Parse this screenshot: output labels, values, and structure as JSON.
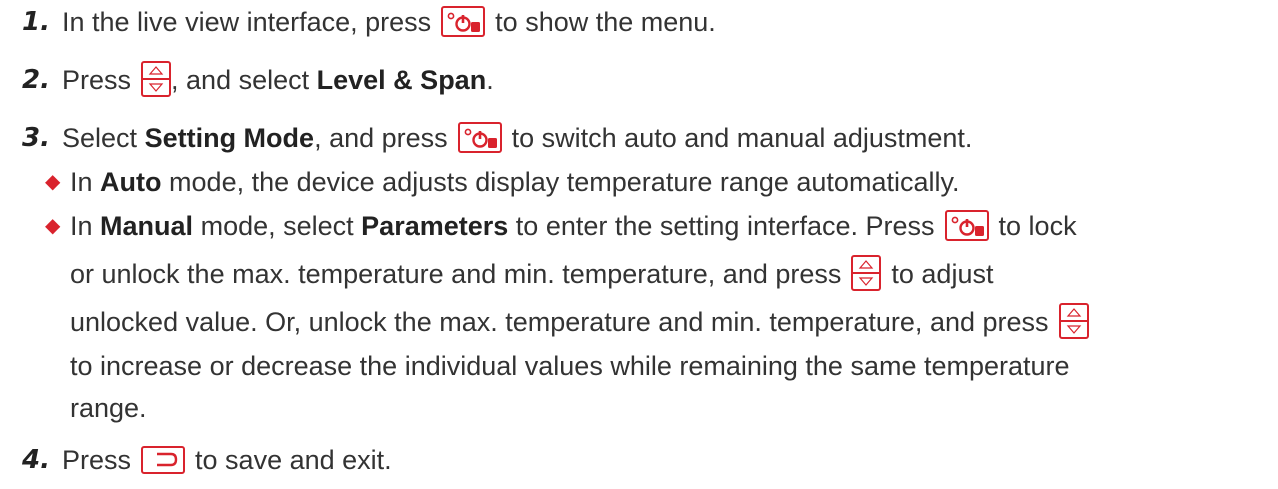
{
  "steps": [
    {
      "number": "1.",
      "seg1": "In the live view interface, press",
      "seg2": "to show the menu."
    },
    {
      "number": "2.",
      "seg1": "Press",
      "seg2": ", and select",
      "bold1": "Level & Span",
      "seg3": "."
    },
    {
      "number": "3.",
      "seg1": "Select",
      "bold1": "Setting Mode",
      "seg2": ", and press",
      "seg3": "to switch auto and manual adjustment."
    },
    {
      "number": "4.",
      "seg1": "Press",
      "seg2": "to save and exit."
    }
  ],
  "bullets": [
    {
      "seg1": "In",
      "bold1": "Auto",
      "seg2": "mode, the device adjusts display temperature range automatically."
    },
    {
      "seg1": "In",
      "bold1": "Manual",
      "seg2": "mode, select",
      "bold2": "Parameters",
      "seg3": "to enter the setting interface. Press",
      "seg4": "to lock",
      "line2a": "or unlock the max. temperature and min. temperature, and press",
      "line2b": "to adjust",
      "line3": "unlocked value. Or, unlock the max. temperature and min. temperature, and press",
      "line4": "to increase or decrease the individual values while remaining the same temperature",
      "line5": "range."
    }
  ],
  "icons": {
    "power": "power-record-key-icon",
    "updown": "up-down-key-icon",
    "back": "back-key-icon"
  },
  "colors": {
    "accent": "#d9232d",
    "text": "#333333"
  }
}
